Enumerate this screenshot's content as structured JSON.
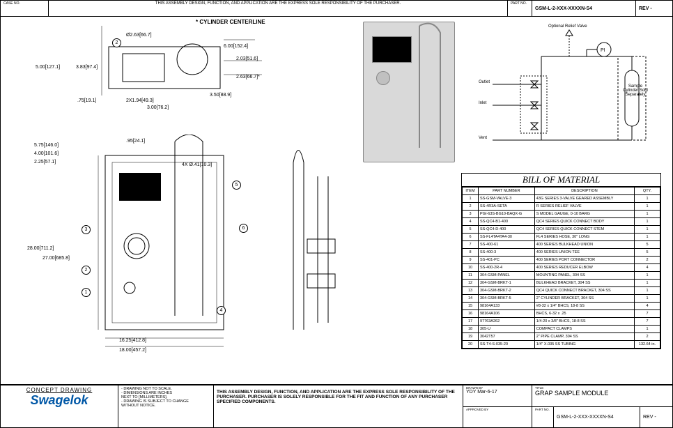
{
  "header": {
    "case_no_label": "CASE\nNO.",
    "disclaimer": "THIS ASSEMBLY DESIGN, FUNCTION, AND APPLICATION\nARE THE EXPRESS SOLE RESPONSIBILITY OF THE PURCHASER.",
    "part_no_label": "PART\nNO.",
    "part_no": "GSM-L-2-XXX-XXXXN-S4",
    "rev_label": "REV -"
  },
  "centerline": "* CYLINDER CENTERLINE",
  "top_dims": {
    "d1": "Ø2.63[66.7]",
    "d2": "6.00[152.4]",
    "d3": "2.03[51.6]",
    "d4": "5.00[127.1]",
    "d5": "3.83[97.4]",
    "d6": "2.63[66.7]*",
    "d7": ".75[19.1]",
    "d8": "2X1.94[49.3]",
    "d9": "3.50[88.9]",
    "d10": "3.00[76.2]"
  },
  "left_dims": {
    "d1": "5.75[146.0]",
    "d2": "4.00[101.6]",
    "d3": "2.25[57.1]",
    "d4": ".95[24.1]",
    "d5": "4X Ø.41[10.3]",
    "d6": "28.00[711.2]",
    "d7": "27.00[685.8]",
    "d8": "16.25[412.8]",
    "d9": "18.00[457.2]"
  },
  "schematic": {
    "optional": "Optional Relief\nValve",
    "pi": "PI",
    "outlet": "Outlet",
    "inlet": "Inlet",
    "vent": "Vent",
    "cyl": "Sample\nCylinder\nSold\nSeparately"
  },
  "bom": {
    "title": "BILL OF MATERIAL",
    "cols": [
      "ITEM",
      "PART NUMBER",
      "DESCRIPTION",
      "QTY."
    ],
    "rows": [
      [
        "1",
        "SS-GSM-VALVE-3",
        "43G SERIES 3-VALVE GEARED ASSEMBLY",
        "1"
      ],
      [
        "2",
        "SS-4R3A-SETA",
        "R SERIES RELIEF VALVE",
        "1"
      ],
      [
        "3",
        "PGI-63S-BG10-BAQX-G",
        "S MODEL GAUGE, 0-10 BARG",
        "1"
      ],
      [
        "4",
        "SS-QC4-B1-400",
        "QC4 SERIES QUICK CONNECT BODY",
        "1"
      ],
      [
        "5",
        "SS-QC4-D-400",
        "QC4 SERIES QUICK CONNECT STEM",
        "1"
      ],
      [
        "6",
        "SS-FL4TA4TA4-30",
        "FL4 SERIES HOSE, 30\" LONG",
        "1"
      ],
      [
        "7",
        "SS-400-61",
        "400 SERIES BULKHEAD UNION",
        "5"
      ],
      [
        "8",
        "SS-400-3",
        "400 SERIES UNION TEE",
        "5"
      ],
      [
        "9",
        "SS-401-PC",
        "400 SERIES PORT CONNECTOR",
        "2"
      ],
      [
        "10",
        "SS-400-2R-4",
        "400 SERIES REDUCER ELBOW",
        "4"
      ],
      [
        "11",
        "304-GSM-PANEL",
        "MOUNTING PANEL, 304 SS",
        "1"
      ],
      [
        "12",
        "304-GSM-BRKT-1",
        "BULKHEAD BRACKET, 304 SS",
        "1"
      ],
      [
        "13",
        "304-GSM-BRKT-2",
        "QC4 QUICK CONNECT BRACKET, 304 SS",
        "1"
      ],
      [
        "14",
        "304-GSM-BRKT-5",
        "2\" CYLINDER BRACKET, 304 SS",
        "1"
      ],
      [
        "15",
        "98164A133",
        "#8-32 x 1/4\" BHCS, 18-8 SS",
        "4"
      ],
      [
        "16",
        "98164A106",
        "BHCS, 6-32 x .25",
        "7"
      ],
      [
        "17",
        "97763A262",
        "1/4-20 x 3/8\" BHCS, 18-8 SS",
        "7"
      ],
      [
        "18",
        "305-U",
        "COMPACT CLAMPS",
        "1"
      ],
      [
        "19",
        "3042T57",
        "2\" PIPE CLAMP, 304 SS",
        "2"
      ],
      [
        "20",
        "SS-T4-S-035-20",
        "1/4\" X.035 SS TUBING",
        "132.64 in."
      ]
    ]
  },
  "footer": {
    "concept": "CONCEPT DRAWING",
    "brand": "Swagelok",
    "notes": [
      "- DRAWING NOT TO SCALE.",
      "- DIMENSIONS ARE INCHES",
      "  NEXT TO [MILLIMETERS].",
      "- DRAWING IS SUBJECT TO CHANGE",
      "  WITHOUT NOTICE."
    ],
    "disc": "THIS ASSEMBLY DESIGN, FUNCTION, AND APPLICATION ARE THE EXPRESS SOLE RESPONSIBILITY OF THE PURCHASER. PURCHASER IS SOLELY RESPONSIBLE FOR THE FIT AND FUNCTION OF ANY PURCHASER SPECIFIED COMPONENTS.",
    "drawn_by_label": "DRAWN BY",
    "drawn_by": "YDY  Mar-6-17",
    "approved_label": "APPROVED BY",
    "title_label": "TITLE",
    "title": "GRAP SAMPLE MODULE",
    "part_no_label": "PART\nNO.",
    "part_no": "GSM-L-2-XXX-XXXXN-S4",
    "rev": "REV -"
  }
}
